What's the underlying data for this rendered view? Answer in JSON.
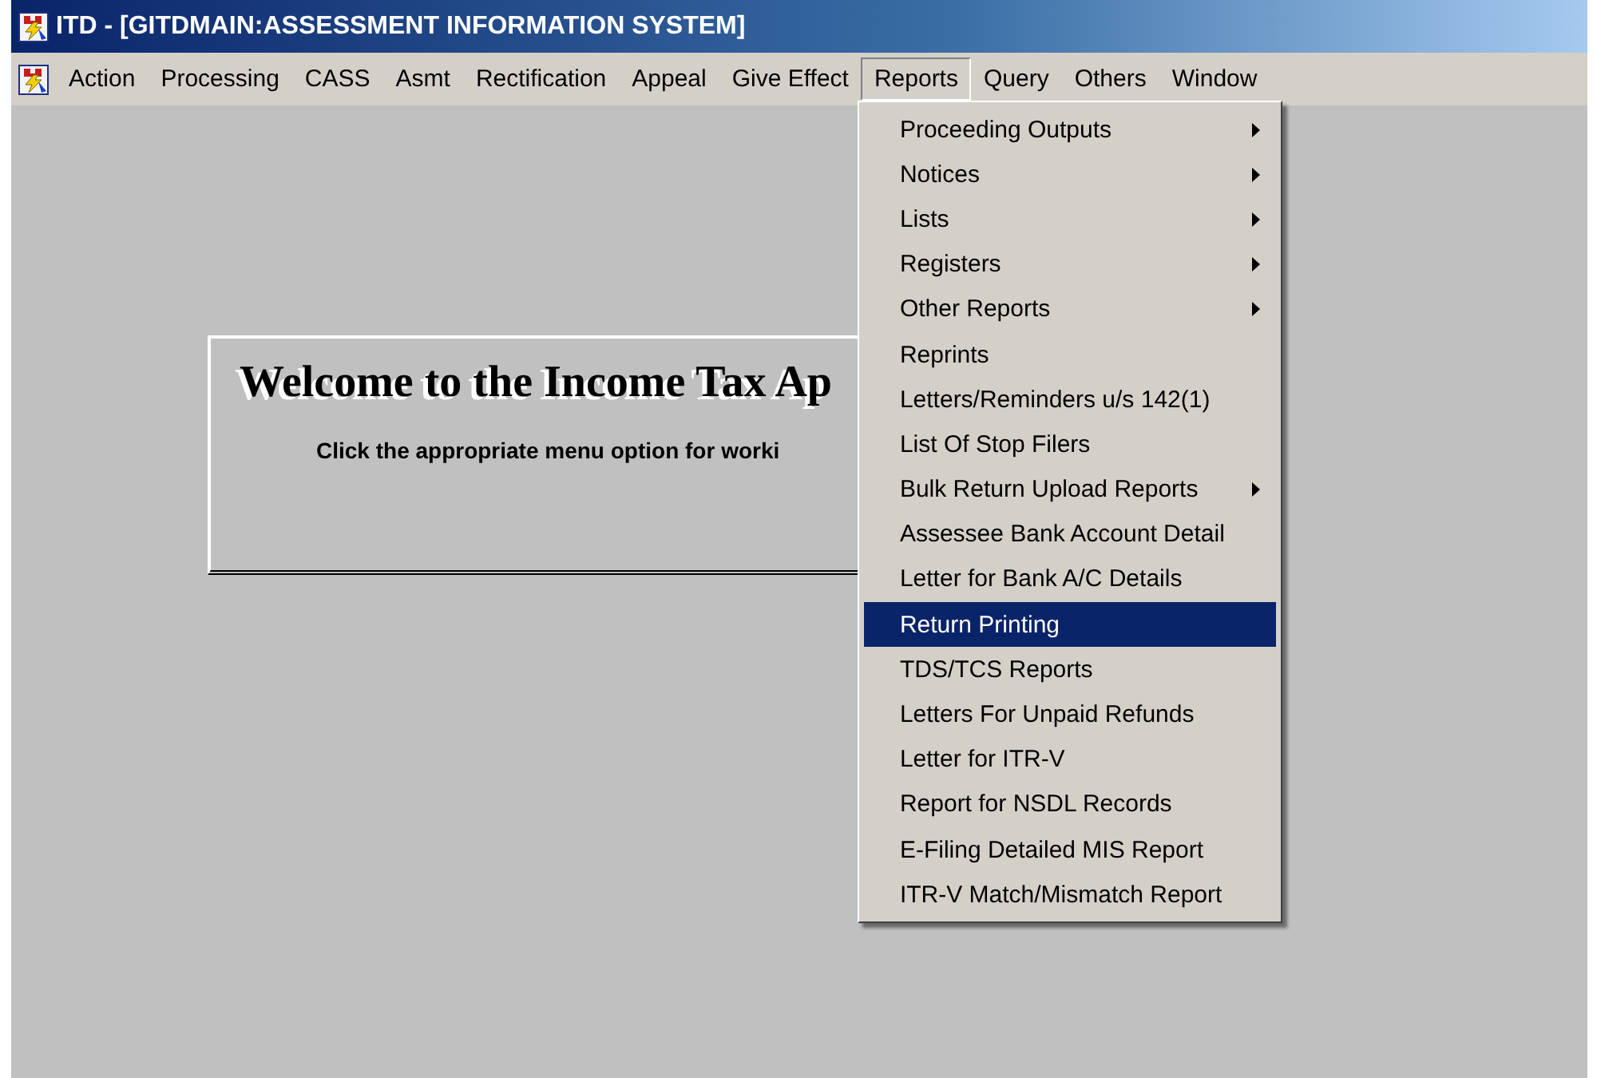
{
  "window": {
    "title": "ITD - [GITDMAIN:ASSESSMENT INFORMATION SYSTEM]"
  },
  "menubar": [
    {
      "label": "Action",
      "selected": false
    },
    {
      "label": "Processing",
      "selected": false
    },
    {
      "label": "CASS",
      "selected": false
    },
    {
      "label": "Asmt",
      "selected": false
    },
    {
      "label": "Rectification",
      "selected": false
    },
    {
      "label": "Appeal",
      "selected": false
    },
    {
      "label": "Give Effect",
      "selected": false
    },
    {
      "label": "Reports",
      "selected": true
    },
    {
      "label": "Query",
      "selected": false
    },
    {
      "label": "Others",
      "selected": false
    },
    {
      "label": "Window",
      "selected": false
    }
  ],
  "reports_menu": [
    {
      "label": "Proceeding Outputs",
      "submenu": true,
      "selected": false
    },
    {
      "label": "Notices",
      "submenu": true,
      "selected": false
    },
    {
      "label": "Lists",
      "submenu": true,
      "selected": false
    },
    {
      "label": "Registers",
      "submenu": true,
      "selected": false
    },
    {
      "label": "Other Reports",
      "submenu": true,
      "selected": false
    },
    {
      "label": "Reprints",
      "submenu": false,
      "selected": false
    },
    {
      "label": "Letters/Reminders u/s 142(1)",
      "submenu": false,
      "selected": false
    },
    {
      "label": "List Of Stop Filers",
      "submenu": false,
      "selected": false
    },
    {
      "label": "Bulk Return Upload Reports",
      "submenu": true,
      "selected": false
    },
    {
      "label": "Assessee Bank Account Detail",
      "submenu": false,
      "selected": false
    },
    {
      "label": "Letter for Bank A/C Details",
      "submenu": false,
      "selected": false
    },
    {
      "label": "Return Printing",
      "submenu": false,
      "selected": true
    },
    {
      "label": "TDS/TCS Reports",
      "submenu": false,
      "selected": false
    },
    {
      "label": "Letters For Unpaid Refunds",
      "submenu": false,
      "selected": false
    },
    {
      "label": "Letter for ITR-V",
      "submenu": false,
      "selected": false
    },
    {
      "label": "Report for NSDL Records",
      "submenu": false,
      "selected": false
    },
    {
      "label": "E-Filing Detailed MIS Report",
      "submenu": false,
      "selected": false
    },
    {
      "label": "ITR-V Match/Mismatch Report",
      "submenu": false,
      "selected": false
    }
  ],
  "welcome_panel": {
    "heading": "Welcome to the Income Tax Ap",
    "message": "Click the appropriate menu option for worki"
  }
}
